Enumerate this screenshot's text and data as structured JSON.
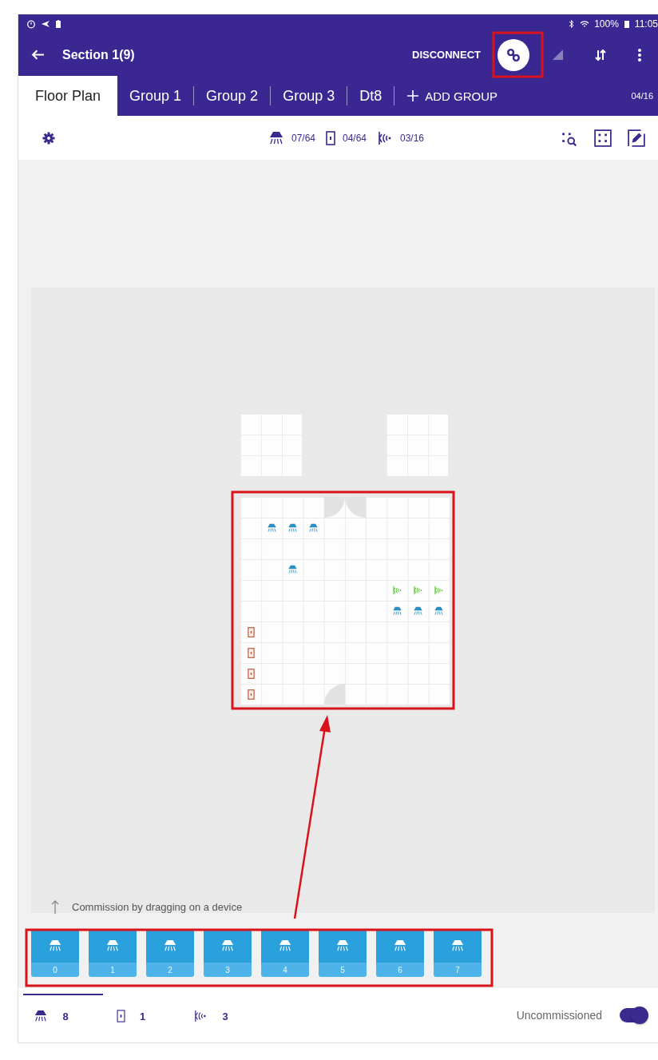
{
  "status_bar": {
    "battery": "100%",
    "time": "11:05"
  },
  "app_bar": {
    "title": "Section 1(9)",
    "action": "DISCONNECT"
  },
  "tabs": [
    {
      "label": "Floor Plan",
      "selected": true
    },
    {
      "label": "Group 1",
      "selected": false
    },
    {
      "label": "Group 2",
      "selected": false
    },
    {
      "label": "Group 3",
      "selected": false
    },
    {
      "label": "Dt8",
      "selected": false
    }
  ],
  "add_group": "ADD GROUP",
  "group_count": "04/16",
  "toolbar": {
    "counts": [
      {
        "kind": "light",
        "text": "07/64"
      },
      {
        "kind": "switch",
        "text": "04/64"
      },
      {
        "kind": "sensor",
        "text": "03/16"
      }
    ]
  },
  "floor_plan": {
    "grid": [
      [
        {
          "kind": "empty"
        },
        {
          "kind": "empty"
        },
        {
          "kind": "empty"
        },
        {
          "kind": "empty"
        },
        {
          "kind": "empty"
        },
        {
          "kind": "empty"
        },
        {
          "kind": "empty"
        },
        {
          "kind": "empty"
        },
        {
          "kind": "empty"
        },
        {
          "kind": "empty"
        }
      ],
      [
        {
          "kind": "empty"
        },
        {
          "kind": "light"
        },
        {
          "kind": "light"
        },
        {
          "kind": "light"
        },
        {
          "kind": "empty"
        },
        {
          "kind": "empty"
        },
        {
          "kind": "empty"
        },
        {
          "kind": "empty"
        },
        {
          "kind": "empty"
        },
        {
          "kind": "empty"
        }
      ],
      [
        {
          "kind": "empty"
        },
        {
          "kind": "empty"
        },
        {
          "kind": "empty"
        },
        {
          "kind": "empty"
        },
        {
          "kind": "empty"
        },
        {
          "kind": "empty"
        },
        {
          "kind": "empty"
        },
        {
          "kind": "empty"
        },
        {
          "kind": "empty"
        },
        {
          "kind": "empty"
        }
      ],
      [
        {
          "kind": "empty"
        },
        {
          "kind": "empty"
        },
        {
          "kind": "light"
        },
        {
          "kind": "empty"
        },
        {
          "kind": "empty"
        },
        {
          "kind": "empty"
        },
        {
          "kind": "empty"
        },
        {
          "kind": "empty"
        },
        {
          "kind": "empty"
        },
        {
          "kind": "empty"
        }
      ],
      [
        {
          "kind": "empty"
        },
        {
          "kind": "empty"
        },
        {
          "kind": "empty"
        },
        {
          "kind": "empty"
        },
        {
          "kind": "empty"
        },
        {
          "kind": "empty"
        },
        {
          "kind": "empty"
        },
        {
          "kind": "sensor"
        },
        {
          "kind": "sensor"
        },
        {
          "kind": "sensor"
        }
      ],
      [
        {
          "kind": "empty"
        },
        {
          "kind": "empty"
        },
        {
          "kind": "empty"
        },
        {
          "kind": "empty"
        },
        {
          "kind": "empty"
        },
        {
          "kind": "empty"
        },
        {
          "kind": "empty"
        },
        {
          "kind": "light"
        },
        {
          "kind": "light"
        },
        {
          "kind": "light"
        }
      ],
      [
        {
          "kind": "switch"
        },
        {
          "kind": "empty"
        },
        {
          "kind": "empty"
        },
        {
          "kind": "empty"
        },
        {
          "kind": "empty"
        },
        {
          "kind": "empty"
        },
        {
          "kind": "empty"
        },
        {
          "kind": "empty"
        },
        {
          "kind": "empty"
        },
        {
          "kind": "empty"
        }
      ],
      [
        {
          "kind": "switch"
        },
        {
          "kind": "empty"
        },
        {
          "kind": "empty"
        },
        {
          "kind": "empty"
        },
        {
          "kind": "empty"
        },
        {
          "kind": "empty"
        },
        {
          "kind": "empty"
        },
        {
          "kind": "empty"
        },
        {
          "kind": "empty"
        },
        {
          "kind": "empty"
        }
      ],
      [
        {
          "kind": "switch"
        },
        {
          "kind": "empty"
        },
        {
          "kind": "empty"
        },
        {
          "kind": "empty"
        },
        {
          "kind": "empty"
        },
        {
          "kind": "empty"
        },
        {
          "kind": "empty"
        },
        {
          "kind": "empty"
        },
        {
          "kind": "empty"
        },
        {
          "kind": "empty"
        }
      ],
      [
        {
          "kind": "switch"
        },
        {
          "kind": "empty"
        },
        {
          "kind": "empty"
        },
        {
          "kind": "empty"
        },
        {
          "kind": "empty"
        },
        {
          "kind": "empty"
        },
        {
          "kind": "empty"
        },
        {
          "kind": "empty"
        },
        {
          "kind": "empty"
        },
        {
          "kind": "empty"
        }
      ]
    ]
  },
  "hint": "Commission by dragging on a device",
  "tray": [
    {
      "kind": "light",
      "label": "0"
    },
    {
      "kind": "light",
      "label": "1"
    },
    {
      "kind": "light",
      "label": "2"
    },
    {
      "kind": "light",
      "label": "3"
    },
    {
      "kind": "light",
      "label": "4"
    },
    {
      "kind": "light",
      "label": "5"
    },
    {
      "kind": "light",
      "label": "6"
    },
    {
      "kind": "light",
      "label": "7"
    }
  ],
  "bottom_tabs": [
    {
      "kind": "light",
      "count": "8",
      "selected": true
    },
    {
      "kind": "switch",
      "count": "1",
      "selected": false
    },
    {
      "kind": "sensor",
      "count": "3",
      "selected": false
    }
  ],
  "filter": {
    "label": "Uncommissioned",
    "on": true
  }
}
